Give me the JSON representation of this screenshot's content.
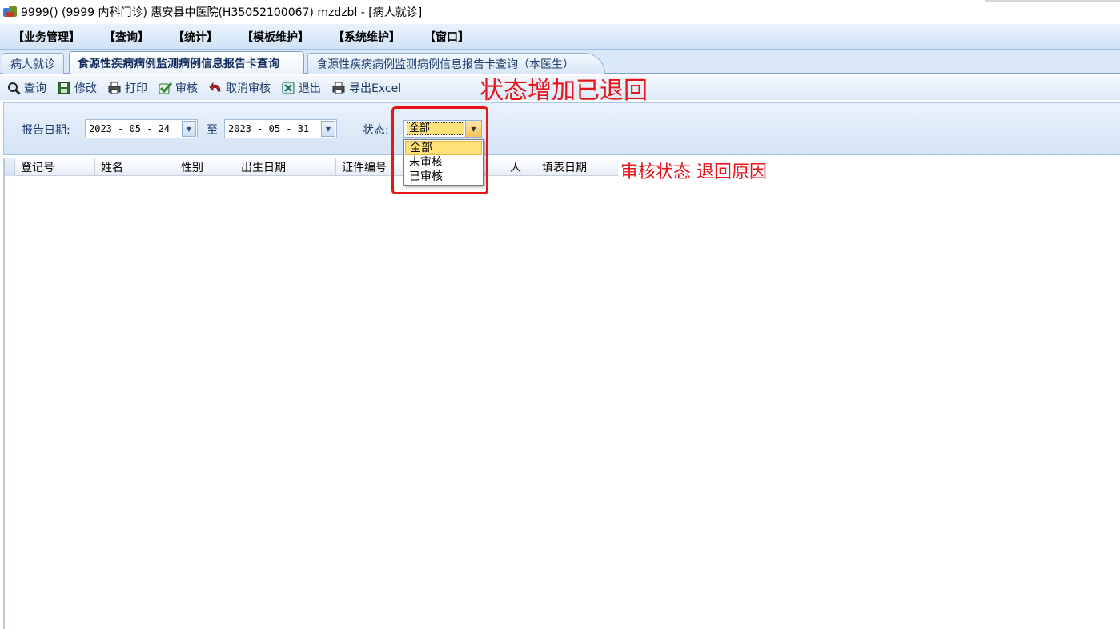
{
  "window": {
    "title": "9999() (9999 内科门诊) 惠安县中医院(H35052100067) mzdzbl - [病人就诊]"
  },
  "menu": [
    "【业务管理】",
    "【查询】",
    "【统计】",
    "【模板维护】",
    "【系统维护】",
    "【窗口】"
  ],
  "tabs": [
    "病人就诊",
    "食源性疾病病例监测病例信息报告卡查询",
    "食源性疾病病例监测病例信息报告卡查询（本医生）"
  ],
  "toolbar": {
    "query": "查询",
    "edit": "修改",
    "print": "打印",
    "audit": "审核",
    "cancel_audit": "取消审核",
    "exit": "退出",
    "export_excel": "导出Excel"
  },
  "filters": {
    "report_date_label": "报告日期:",
    "date_from": "2023 - 05 - 24",
    "to_label": "至",
    "date_to": "2023 - 05 - 31",
    "status_label": "状态:",
    "status_value": "全部",
    "dropdown_options": [
      "全部",
      "未审核",
      "已审核"
    ]
  },
  "grid": {
    "columns": [
      "登记号",
      "姓名",
      "性别",
      "出生日期",
      "证件编号",
      "人",
      "填表日期"
    ]
  },
  "annotations": {
    "big_note": "状态增加已退回",
    "small_note": "审核状态 退回原因",
    "color": "#e8141a"
  }
}
